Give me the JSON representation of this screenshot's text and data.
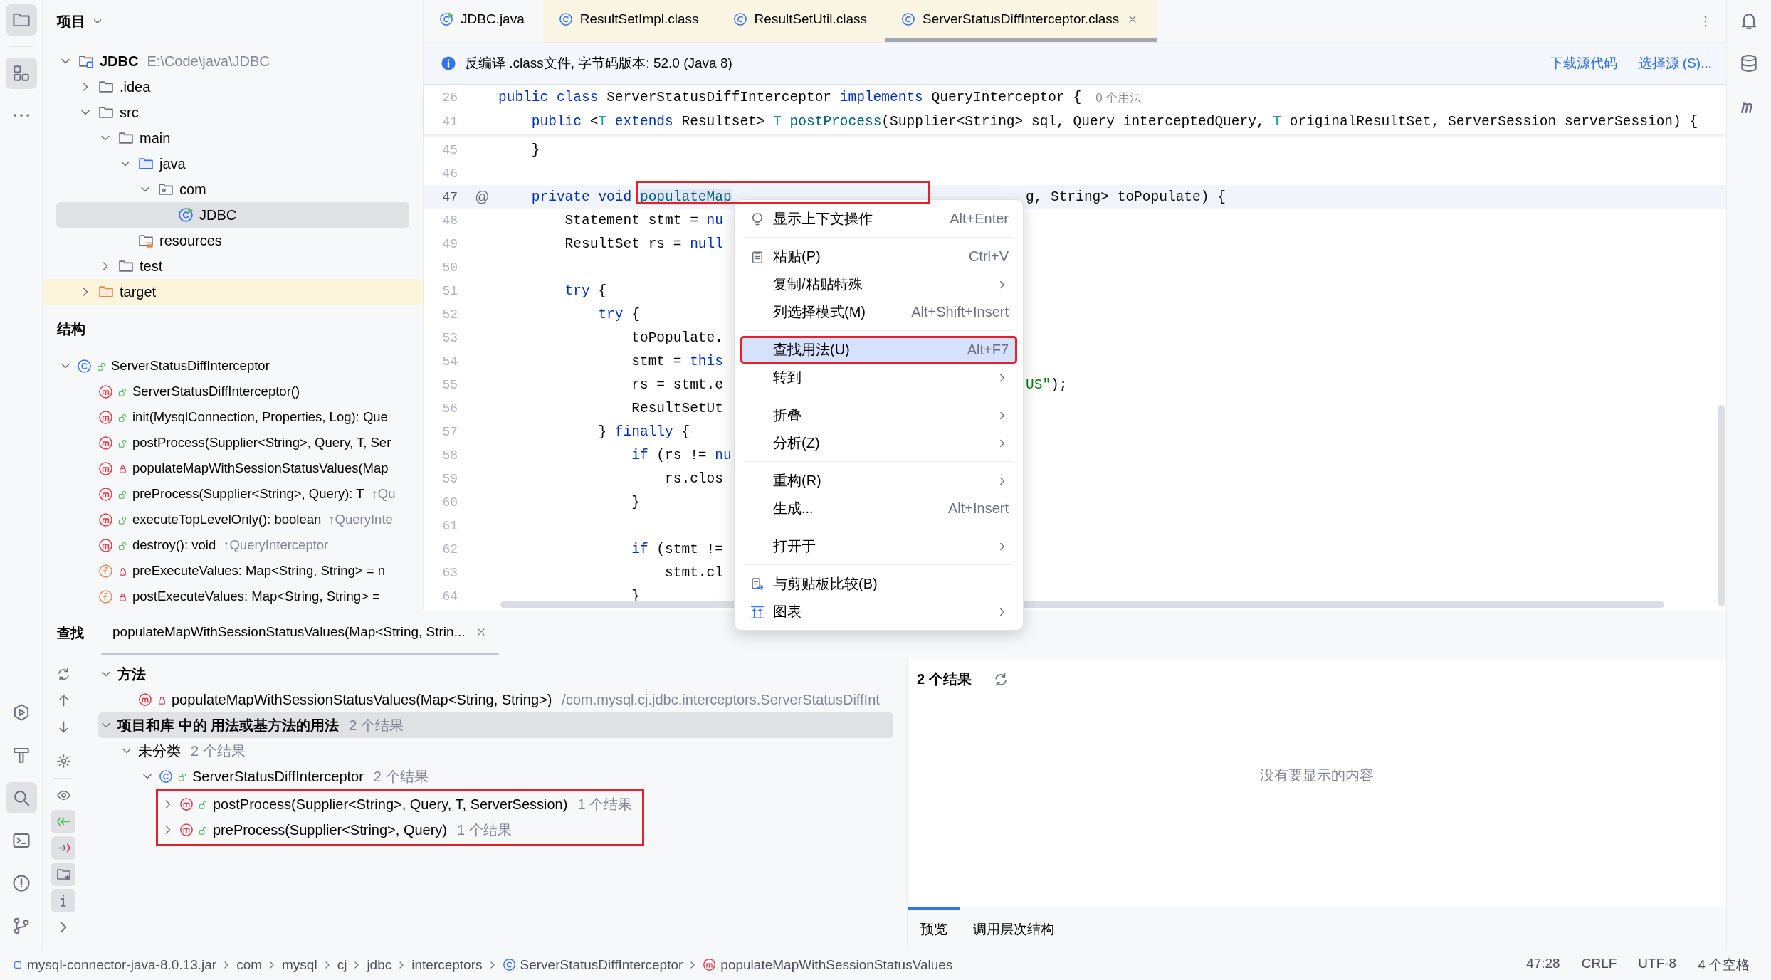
{
  "tool_strip": {
    "top": [
      {
        "selected": true
      },
      {
        "selected": true
      }
    ],
    "bottom": [
      {
        "selected": false
      },
      {
        "selected": false
      },
      {
        "selected": true
      },
      {
        "selected": false
      },
      {
        "selected": false
      },
      {
        "selected": false
      }
    ]
  },
  "project_panel": {
    "title": "项目",
    "tree": [
      {
        "label": "JDBC",
        "path": "E:\\Code\\java\\JDBC",
        "kind": "module",
        "expanded": true,
        "selected": false,
        "children": [
          {
            "label": ".idea",
            "kind": "folder",
            "expanded": false,
            "selected": false
          },
          {
            "label": "src",
            "kind": "folder",
            "expanded": true,
            "selected": false,
            "children": [
              {
                "label": "main",
                "kind": "folder",
                "expanded": true,
                "selected": false,
                "children": [
                  {
                    "label": "java",
                    "kind": "source",
                    "expanded": true,
                    "selected": false,
                    "children": [
                      {
                        "label": "com",
                        "kind": "package",
                        "expanded": true,
                        "selected": false,
                        "children": [
                          {
                            "label": "JDBC",
                            "kind": "class",
                            "selected": true
                          }
                        ]
                      }
                    ]
                  },
                  {
                    "label": "resources",
                    "kind": "resources",
                    "selected": false
                  }
                ]
              },
              {
                "label": "test",
                "kind": "folder",
                "expanded": false,
                "selected": false
              }
            ]
          },
          {
            "label": "target",
            "kind": "excluded",
            "expanded": false,
            "selected": false
          }
        ]
      }
    ]
  },
  "structure_panel": {
    "title": "结构",
    "tree": [
      {
        "label": "ServerStatusDiffInterceptor",
        "kind": "class",
        "private": false,
        "expanded": true,
        "children": [
          {
            "label": "ServerStatusDiffInterceptor()",
            "kind": "method",
            "private": false
          },
          {
            "label": "init(MysqlConnection, Properties, Log): Que",
            "kind": "method",
            "private": false
          },
          {
            "label": "postProcess(Supplier<String>, Query, T, Ser",
            "kind": "method",
            "private": false
          },
          {
            "label": "populateMapWithSessionStatusValues(Map",
            "kind": "method",
            "private": true
          },
          {
            "label": "preProcess(Supplier<String>, Query): T",
            "kind": "method",
            "private": false,
            "inherited": "↑Qu"
          },
          {
            "label": "executeTopLevelOnly(): boolean",
            "kind": "method",
            "private": false,
            "inherited": "↑QueryInte"
          },
          {
            "label": "destroy(): void",
            "kind": "method",
            "private": false,
            "inherited": "↑QueryInterceptor"
          },
          {
            "label": "preExecuteValues: Map<String, String> = n",
            "kind": "field",
            "private": true
          },
          {
            "label": "postExecuteValues: Map<String, String> =",
            "kind": "field",
            "private": true
          }
        ]
      }
    ]
  },
  "editor": {
    "tabs": [
      {
        "label": "JDBC.java",
        "kind": "source",
        "selected": false
      },
      {
        "label": "ResultSetImpl.class",
        "kind": "library",
        "selected": false
      },
      {
        "label": "ResultSetUtil.class",
        "kind": "library",
        "selected": false
      },
      {
        "label": "ServerStatusDiffInterceptor.class",
        "kind": "library",
        "selected": true
      }
    ],
    "banner": {
      "text": "反编译 .class文件, 字节码版本: 52.0 (Java 8)",
      "actions": [
        "下载源代码",
        "选择源 (S)..."
      ]
    },
    "sticky_lines": [
      {
        "number": "26",
        "tokens": [
          {
            "text": "public class ",
            "kind": "keyword"
          },
          {
            "text": "ServerStatusDiffInterceptor ",
            "kind": "plain"
          },
          {
            "text": "implements ",
            "kind": "keyword"
          },
          {
            "text": "QueryInterceptor {",
            "kind": "plain"
          }
        ],
        "hint": "0 个用法"
      },
      {
        "number": "41",
        "tokens": [
          {
            "text": "    public ",
            "kind": "keyword"
          },
          {
            "text": "<",
            "kind": "plain"
          },
          {
            "text": "T ",
            "kind": "type_param"
          },
          {
            "text": "extends ",
            "kind": "keyword"
          },
          {
            "text": "Resultset> ",
            "kind": "plain"
          },
          {
            "text": "T ",
            "kind": "type_param"
          },
          {
            "text": "postProcess",
            "kind": "method"
          },
          {
            "text": "(Supplier<String> sql, Query interceptedQuery, ",
            "kind": "plain"
          },
          {
            "text": "T ",
            "kind": "type_param"
          },
          {
            "text": "originalResultSet, ServerSession serverSession) {",
            "kind": "plain"
          }
        ]
      }
    ],
    "lines": [
      {
        "number": "45",
        "current": false,
        "tokens": [
          {
            "text": "    }",
            "kind": "plain"
          }
        ]
      },
      {
        "number": "46",
        "current": false
      },
      {
        "number": "47",
        "current": true,
        "marker": "@",
        "tokens": [
          {
            "text": "    private void ",
            "kind": "keyword"
          },
          {
            "text": "populateMap",
            "kind": "method",
            "highlighted": true,
            "annotated": true
          }
        ],
        "tail": [
          {
            "text": "g, String> toPopulate) {",
            "kind": "plain"
          }
        ]
      },
      {
        "number": "48",
        "current": false,
        "tokens": [
          {
            "text": "        Statement stmt = ",
            "kind": "plain"
          },
          {
            "text": "nu",
            "kind": "keyword"
          }
        ]
      },
      {
        "number": "49",
        "current": false,
        "tokens": [
          {
            "text": "        ResultSet rs = ",
            "kind": "plain"
          },
          {
            "text": "null",
            "kind": "keyword"
          }
        ]
      },
      {
        "number": "50",
        "current": false
      },
      {
        "number": "51",
        "current": false,
        "tokens": [
          {
            "text": "        try",
            "kind": "keyword"
          },
          {
            "text": " {",
            "kind": "plain"
          }
        ]
      },
      {
        "number": "52",
        "current": false,
        "tokens": [
          {
            "text": "            try",
            "kind": "keyword"
          },
          {
            "text": " {",
            "kind": "plain"
          }
        ]
      },
      {
        "number": "53",
        "current": false,
        "tokens": [
          {
            "text": "                toPopulate.",
            "kind": "plain"
          }
        ]
      },
      {
        "number": "54",
        "current": false,
        "tokens": [
          {
            "text": "                stmt = ",
            "kind": "plain"
          },
          {
            "text": "this",
            "kind": "keyword"
          }
        ]
      },
      {
        "number": "55",
        "current": false,
        "tokens": [
          {
            "text": "                rs = stmt.e",
            "kind": "plain"
          }
        ],
        "tail": [
          {
            "text": "US\"",
            "kind": "string"
          },
          {
            "text": ");",
            "kind": "plain"
          }
        ]
      },
      {
        "number": "56",
        "current": false,
        "tokens": [
          {
            "text": "                ResultSetUt",
            "kind": "plain"
          }
        ]
      },
      {
        "number": "57",
        "current": false,
        "tokens": [
          {
            "text": "            } ",
            "kind": "plain"
          },
          {
            "text": "finally",
            "kind": "keyword"
          },
          {
            "text": " {",
            "kind": "plain"
          }
        ]
      },
      {
        "number": "58",
        "current": false,
        "tokens": [
          {
            "text": "                if",
            "kind": "keyword"
          },
          {
            "text": " (rs != ",
            "kind": "plain"
          },
          {
            "text": "nu",
            "kind": "keyword"
          }
        ]
      },
      {
        "number": "59",
        "current": false,
        "tokens": [
          {
            "text": "                    rs.clos",
            "kind": "plain"
          }
        ]
      },
      {
        "number": "60",
        "current": false,
        "tokens": [
          {
            "text": "                }",
            "kind": "plain"
          }
        ]
      },
      {
        "number": "61",
        "current": false
      },
      {
        "number": "62",
        "current": false,
        "tokens": [
          {
            "text": "                if",
            "kind": "keyword"
          },
          {
            "text": " (stmt !=",
            "kind": "plain"
          }
        ]
      },
      {
        "number": "63",
        "current": false,
        "tokens": [
          {
            "text": "                    stmt.cl",
            "kind": "plain"
          }
        ]
      },
      {
        "number": "64",
        "current": false,
        "tokens": [
          {
            "text": "                }",
            "kind": "plain"
          }
        ]
      }
    ]
  },
  "context_menu": {
    "items": [
      {
        "kind": "item",
        "label": "显示上下文操作",
        "shortcut": "Alt+Enter",
        "submenu": false,
        "selected": false,
        "annotated": false
      },
      {
        "kind": "separator"
      },
      {
        "kind": "item",
        "label": "粘贴(P)",
        "shortcut": "Ctrl+V",
        "submenu": false,
        "selected": false,
        "annotated": false
      },
      {
        "kind": "item",
        "label": "复制/粘贴特殊",
        "submenu": true,
        "selected": false,
        "annotated": false
      },
      {
        "kind": "item",
        "label": "列选择模式(M)",
        "shortcut": "Alt+Shift+Insert",
        "submenu": false,
        "selected": false,
        "annotated": false
      },
      {
        "kind": "separator"
      },
      {
        "kind": "item",
        "label": "查找用法(U)",
        "shortcut": "Alt+F7",
        "submenu": false,
        "selected": true,
        "annotated": true
      },
      {
        "kind": "item",
        "label": "转到",
        "submenu": true,
        "selected": false,
        "annotated": false
      },
      {
        "kind": "separator"
      },
      {
        "kind": "item",
        "label": "折叠",
        "submenu": true,
        "selected": false,
        "annotated": false
      },
      {
        "kind": "item",
        "label": "分析(Z)",
        "submenu": true,
        "selected": false,
        "annotated": false
      },
      {
        "kind": "separator"
      },
      {
        "kind": "item",
        "label": "重构(R)",
        "submenu": true,
        "selected": false,
        "annotated": false
      },
      {
        "kind": "item",
        "label": "生成...",
        "shortcut": "Alt+Insert",
        "submenu": false,
        "selected": false,
        "annotated": false
      },
      {
        "kind": "separator"
      },
      {
        "kind": "item",
        "label": "打开于",
        "submenu": true,
        "selected": false,
        "annotated": false
      },
      {
        "kind": "separator"
      },
      {
        "kind": "item",
        "label": "与剪贴板比较(B)",
        "submenu": false,
        "selected": false,
        "annotated": false
      },
      {
        "kind": "item",
        "label": "图表",
        "submenu": true,
        "selected": false,
        "annotated": false
      }
    ]
  },
  "find_panel": {
    "title": "查找",
    "tabs": [
      {
        "label": "populateMapWithSessionStatusValues(Map<String, Strin...",
        "selected": true
      }
    ],
    "toolbar": [
      {
        "selected": false
      },
      {
        "selected": false
      },
      {
        "selected": false
      },
      {
        "selected": false
      },
      {
        "selected": false
      },
      {
        "selected": true
      },
      {
        "selected": true
      },
      {
        "selected": true
      },
      {
        "selected": true
      },
      {
        "selected": false
      }
    ],
    "tree": [
      {
        "label": "方法",
        "kind": "group",
        "expanded": true,
        "selected": false,
        "annotated": false,
        "children": [
          {
            "label": "populateMapWithSessionStatusValues(Map<String, String>)",
            "kind": "method",
            "private": true,
            "location": "/com.mysql.cj.jdbc.interceptors.ServerStatusDiffInt",
            "selected": false,
            "annotated": false
          }
        ]
      },
      {
        "label": "项目和库 中的 用法或基方法的用法",
        "kind": "group",
        "count": "2 个结果",
        "expanded": true,
        "selected": true,
        "annotated": false,
        "children": [
          {
            "label": "未分类",
            "kind": "category",
            "count": "2 个结果",
            "expanded": true,
            "selected": false,
            "annotated": false,
            "children": [
              {
                "label": "ServerStatusDiffInterceptor",
                "kind": "class",
                "private": false,
                "count": "2 个结果",
                "expanded": true,
                "selected": false,
                "annotated": false,
                "children": [
                  {
                    "label": "postProcess(Supplier<String>, Query, T, ServerSession)",
                    "kind": "method",
                    "private": false,
                    "count": "1 个结果",
                    "expanded": false,
                    "selected": false,
                    "annotated": true
                  },
                  {
                    "label": "preProcess(Supplier<String>, Query)",
                    "kind": "method",
                    "private": false,
                    "count": "1 个结果",
                    "expanded": false,
                    "selected": false,
                    "annotated": true
                  }
                ]
              }
            ]
          }
        ]
      }
    ],
    "preview": {
      "count": "2 个结果",
      "empty_text": "没有要显示的内容",
      "tabs": [
        {
          "label": "预览",
          "selected": true
        },
        {
          "label": "调用层次结构",
          "selected": false
        }
      ]
    }
  },
  "status_bar": {
    "breadcrumbs": [
      {
        "label": "mysql-connector-java-8.0.13.jar",
        "kind": "jar"
      },
      {
        "label": "com",
        "kind": "package"
      },
      {
        "label": "mysql",
        "kind": "package"
      },
      {
        "label": "cj",
        "kind": "package"
      },
      {
        "label": "jdbc",
        "kind": "package"
      },
      {
        "label": "interceptors",
        "kind": "package"
      },
      {
        "label": "ServerStatusDiffInterceptor",
        "kind": "class"
      },
      {
        "label": "populateMapWithSessionStatusValues",
        "kind": "method"
      }
    ],
    "items": [
      "47:28",
      "CRLF",
      "UTF-8",
      "4 个空格"
    ]
  }
}
